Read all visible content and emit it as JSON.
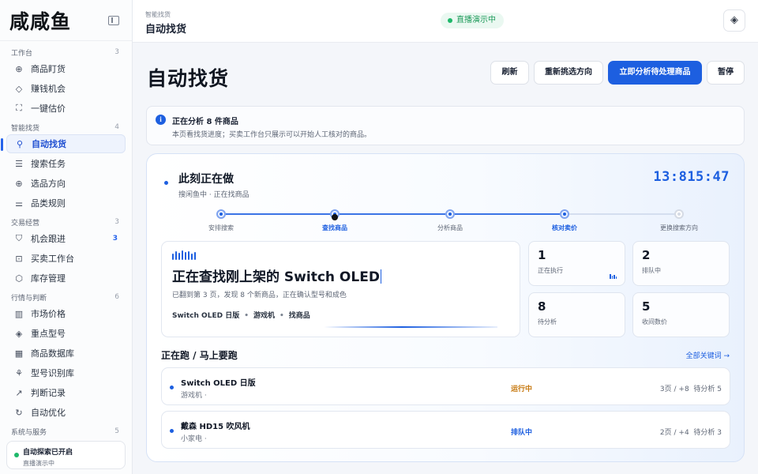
{
  "app": {
    "logo": "咸咸鱼",
    "collapse_icon": "sidebar-collapse-icon"
  },
  "sidebar": {
    "groups": [
      {
        "label": "工作台",
        "count": "3",
        "items": [
          {
            "label": "商品盯货",
            "icon": "target-icon",
            "symbol": "⊕"
          },
          {
            "label": "赚钱机会",
            "icon": "drop-icon",
            "symbol": "◇"
          },
          {
            "label": "一键估价",
            "icon": "scan-icon",
            "symbol": "⛶"
          }
        ]
      },
      {
        "label": "智能找货",
        "count": "4",
        "items": [
          {
            "label": "自动找货",
            "icon": "search-icon",
            "symbol": "⚲",
            "active": true
          },
          {
            "label": "搜索任务",
            "icon": "list-icon",
            "symbol": "☰"
          },
          {
            "label": "选品方向",
            "icon": "compass-icon",
            "symbol": "⊕"
          },
          {
            "label": "品类规则",
            "icon": "sliders-icon",
            "symbol": "⚌"
          }
        ]
      },
      {
        "label": "交易经营",
        "count": "3",
        "items": [
          {
            "label": "机会跟进",
            "icon": "bookmark-icon",
            "symbol": "⛉",
            "badge": "3"
          },
          {
            "label": "买卖工作台",
            "icon": "briefcase-icon",
            "symbol": "⊡"
          },
          {
            "label": "库存管理",
            "icon": "box-icon",
            "symbol": "⬡"
          }
        ]
      },
      {
        "label": "行情与判断",
        "count": "6",
        "items": [
          {
            "label": "市场价格",
            "icon": "bar-chart-icon",
            "symbol": "▥"
          },
          {
            "label": "重点型号",
            "icon": "tag-icon",
            "symbol": "◈"
          },
          {
            "label": "商品数据库",
            "icon": "grid-icon",
            "symbol": "▦"
          },
          {
            "label": "型号识别库",
            "icon": "network-icon",
            "symbol": "⚘"
          },
          {
            "label": "判断记录",
            "icon": "trend-icon",
            "symbol": "↗"
          },
          {
            "label": "自动优化",
            "icon": "refresh-icon",
            "symbol": "↻"
          }
        ]
      },
      {
        "label": "系统与服务",
        "count": "5",
        "items": []
      }
    ],
    "status": {
      "title": "自动探索已开启",
      "subtitle": "直播演示中",
      "color": "#1eb86a"
    }
  },
  "topbar": {
    "breadcrumb": "智能找货",
    "title": "自动找货",
    "live_label": "直播演示中",
    "action_icon": "diamond-arrow-icon"
  },
  "main": {
    "title": "自动找货",
    "buttons": {
      "refresh": "刷新",
      "reselect": "重新挑选方向",
      "analyze": "立即分析待处理商品",
      "pause": "暂停"
    },
    "info": {
      "title": "正在分析 8 件商品",
      "desc": "本页看找货进度；买卖工作台只展示可以开始人工核对的商品。"
    },
    "now": {
      "title": "此刻正在做",
      "subtitle": "搜闲鱼中 · 正在找商品",
      "clock": "13:815:47",
      "steps": [
        {
          "label": "安排搜索",
          "state": "done"
        },
        {
          "label": "查找商品",
          "state": "current"
        },
        {
          "label": "分析商品",
          "state": "done"
        },
        {
          "label": "核对卖价",
          "state": "current"
        },
        {
          "label": "更换搜索方向",
          "state": "todo"
        }
      ]
    },
    "search": {
      "headline": "正在查找刚上架的 Switch OLED",
      "desc": "已翻到第 3 页，发现 8 个新商品，正在确认型号和成色",
      "tags": [
        "Switch OLED 日版",
        "游戏机",
        "找商品"
      ]
    },
    "stats": [
      {
        "value": "1",
        "label": "正在执行"
      },
      {
        "value": "2",
        "label": "排队中"
      },
      {
        "value": "8",
        "label": "待分析"
      },
      {
        "value": "5",
        "label": "收间数价"
      }
    ],
    "running": {
      "title": "正在跑 / 马上要跑",
      "link": "全部关键词 →",
      "rows": [
        {
          "name": "Switch OLED 日版",
          "category": "游戏机 ·",
          "state": "运行中",
          "state_color": "#c77a12",
          "pages": "3页 / +8",
          "pending": "待分析 5"
        },
        {
          "name": "戴森 HD15 吹风机",
          "category": "小家电 ·",
          "state": "排队中",
          "state_color": "#1d5fe0",
          "pages": "2页 / +4",
          "pending": "待分析 3"
        }
      ]
    }
  }
}
